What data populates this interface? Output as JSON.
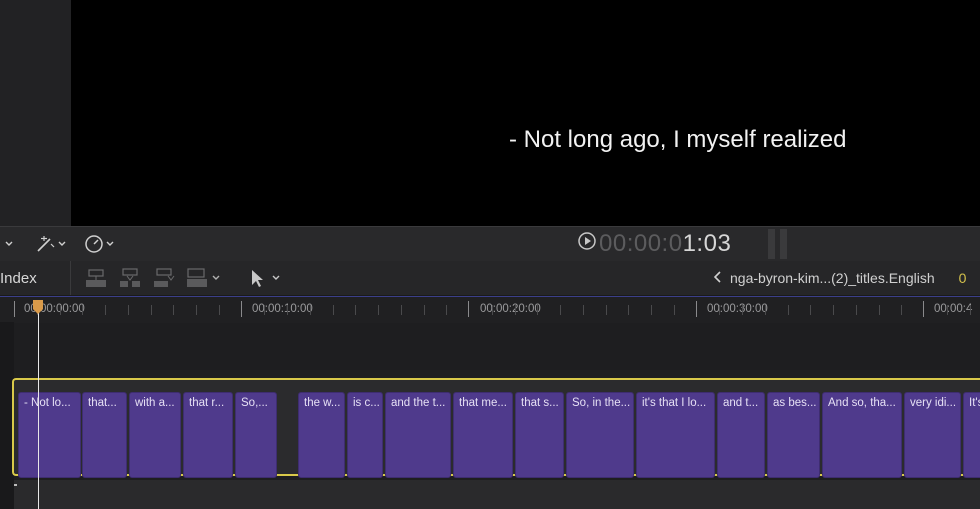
{
  "viewer": {
    "subtitle": "- Not long ago, I myself realized"
  },
  "viewer_controls": {
    "timecode_dim": "00:00:0",
    "timecode_bright": "1:03",
    "icons": [
      "chevron-down-icon",
      "magic-wand-icon",
      "speedometer-icon",
      "play-circle-icon"
    ]
  },
  "toolbar": {
    "index_label": "Index",
    "project_name": "nga-byron-kim...(2)_titles.English",
    "extra_timecode": "0"
  },
  "ruler": {
    "labels": [
      "00:00:00:00",
      "00:00:10:00",
      "00:00:20:00",
      "00:00:30:00",
      "00:00:4"
    ]
  },
  "clips": [
    "- Not lo...",
    "that...",
    "with a...",
    "that r...",
    "So,...",
    "the w...",
    "is c...",
    "and the t...",
    "that me...",
    "that s...",
    "So, in the...",
    "it's that I lo...",
    "and t...",
    "as bes...",
    "And so, tha...",
    "very idi...",
    "It's"
  ],
  "colors": {
    "clip": "#4f3a8c",
    "track_border": "#d9c94a",
    "playhead": "#d99a4a"
  }
}
